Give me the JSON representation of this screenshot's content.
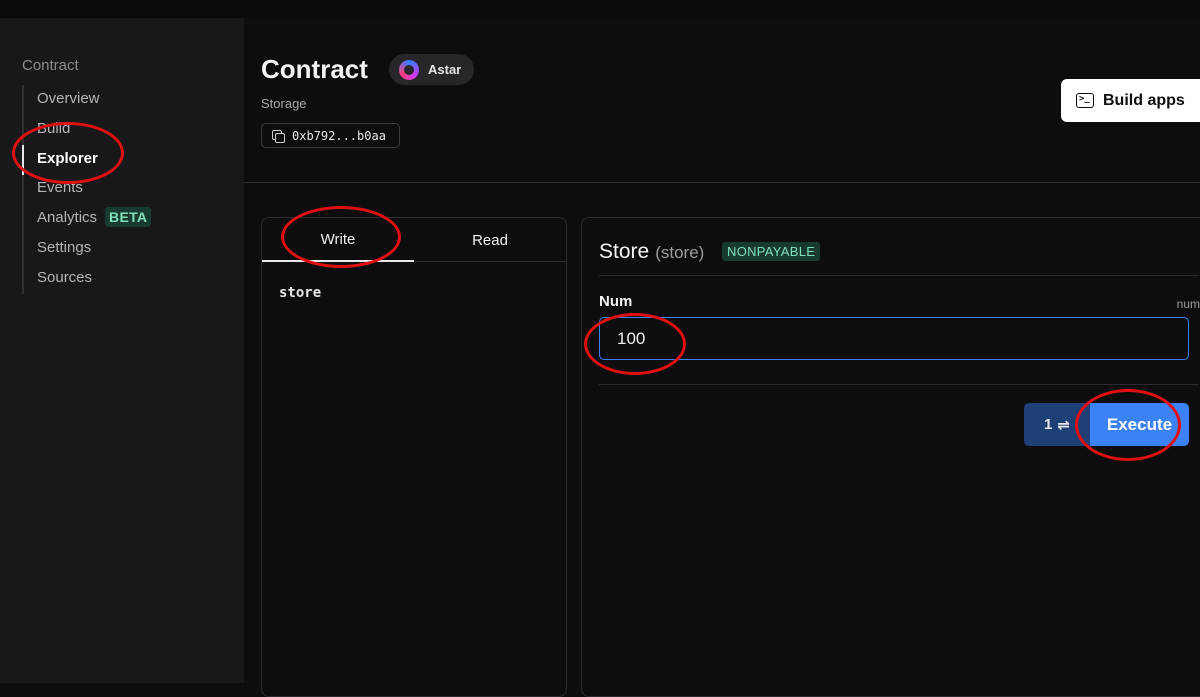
{
  "sidebar": {
    "heading": "Contract",
    "items": [
      {
        "label": "Overview",
        "active": false
      },
      {
        "label": "Build",
        "active": false
      },
      {
        "label": "Explorer",
        "active": true
      },
      {
        "label": "Events",
        "active": false
      },
      {
        "label": "Analytics",
        "active": false,
        "badge": "BETA"
      },
      {
        "label": "Settings",
        "active": false
      },
      {
        "label": "Sources",
        "active": false
      }
    ]
  },
  "header": {
    "title": "Contract",
    "chain": "Astar",
    "contract_name": "Storage",
    "address": "0xb792...b0aa",
    "build_apps_label": "Build apps"
  },
  "tabs": [
    {
      "label": "Write",
      "active": true
    },
    {
      "label": "Read",
      "active": false
    }
  ],
  "functions": [
    "store"
  ],
  "function_detail": {
    "name": "Store",
    "signature": "(store)",
    "mutability": "NONPAYABLE",
    "param_label": "Num",
    "param_type": "num",
    "param_value": "100",
    "value_button": "1",
    "value_icon": "⇌",
    "execute_label": "Execute"
  },
  "colors": {
    "accent": "#3b82f6",
    "annotation": "#e01010",
    "badge_bg": "#173b30",
    "badge_text": "#7fe0b8"
  }
}
